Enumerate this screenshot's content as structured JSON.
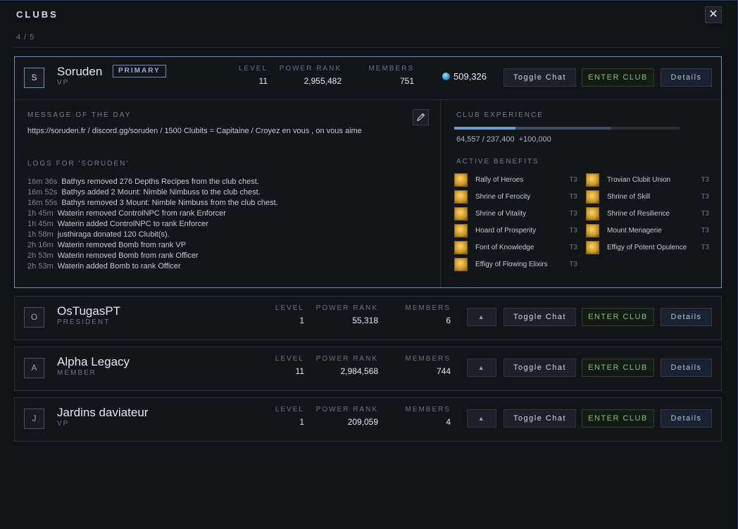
{
  "window": {
    "title": "CLUBS",
    "count": "4 / 5",
    "close_label": "✕"
  },
  "buttons": {
    "toggle_chat": "Toggle Chat",
    "enter_club": "ENTER CLUB",
    "details": "Details",
    "up": "▲"
  },
  "stat_labels": {
    "level": "LEVEL",
    "power_rank": "POWER RANK",
    "members": "MEMBERS"
  },
  "primary_club": {
    "initial": "S",
    "name": "Soruden",
    "badge": "PRIMARY",
    "rank": "VP",
    "level": "11",
    "power_rank": "2,955,482",
    "members": "751",
    "currency": "509,326",
    "motd_label": "MESSAGE OF THE DAY",
    "motd": "https://soruden.fr / discord.gg/soruden / 1500 Clubits = Capitaine / Croyez en vous , on vous aime",
    "logs_label": "LOGS FOR 'SORUDEN'",
    "logs": [
      {
        "time": "16m 36s",
        "text": "Bathys removed 276 Depths Recipes from the club chest."
      },
      {
        "time": "16m 52s",
        "text": "Bathys added 2 Mount: Nimble Nimbuss to the club chest."
      },
      {
        "time": "16m 55s",
        "text": "Bathys removed 3 Mount: Nimble Nimbuss from the club chest."
      },
      {
        "time": "1h 45m",
        "text": "Waterin removed ControlNPC from rank Enforcer"
      },
      {
        "time": "1h 45m",
        "text": "Waterin added ControlNPC to rank Enforcer"
      },
      {
        "time": "1h 58m",
        "text": "justhiraga donated 120 Clubit(s)."
      },
      {
        "time": "2h 16m",
        "text": "Waterin removed Bomb from rank VP"
      },
      {
        "time": "2h 53m",
        "text": "Waterin removed Bomb from rank Officer"
      },
      {
        "time": "2h 53m",
        "text": "Waterin added Bomb to rank Officer"
      }
    ],
    "experience_label": "CLUB EXPERIENCE",
    "experience_text": "64,557 / 237,400",
    "experience_bonus": "+100,000",
    "experience_fraction": 0.272,
    "experience_bonus_fraction": 0.421,
    "benefits_label": "ACTIVE BENEFITS",
    "benefits": [
      {
        "name": "Rally of Heroes",
        "tier": "T3",
        "icon": "rally-icon"
      },
      {
        "name": "Trovian Clubit Union",
        "tier": "T3",
        "icon": "union-icon"
      },
      {
        "name": "Shrine of Ferocity",
        "tier": "T3",
        "icon": "ferocity-icon"
      },
      {
        "name": "Shrine of Skill",
        "tier": "T3",
        "icon": "skill-icon"
      },
      {
        "name": "Shrine of Vitality",
        "tier": "T3",
        "icon": "vitality-icon"
      },
      {
        "name": "Shrine of Resilience",
        "tier": "T3",
        "icon": "resilience-icon"
      },
      {
        "name": "Hoard of Prosperity",
        "tier": "T3",
        "icon": "prosperity-icon"
      },
      {
        "name": "Mount Menagerie",
        "tier": "T3",
        "icon": "menagerie-icon"
      },
      {
        "name": "Font of Knowledge",
        "tier": "T3",
        "icon": "knowledge-icon"
      },
      {
        "name": "Effigy of Potent Opulence",
        "tier": "T3",
        "icon": "opulence-icon"
      },
      {
        "name": "Effigy of Flowing Elixirs",
        "tier": "T3",
        "icon": "elixirs-icon"
      }
    ]
  },
  "other_clubs": [
    {
      "initial": "O",
      "name": "OsTugasPT",
      "rank": "PRESIDENT",
      "level": "1",
      "power_rank": "55,318",
      "members": "6"
    },
    {
      "initial": "A",
      "name": "Alpha Legacy",
      "rank": "MEMBER",
      "level": "11",
      "power_rank": "2,984,568",
      "members": "744"
    },
    {
      "initial": "J",
      "name": "Jardins daviateur",
      "rank": "VP",
      "level": "1",
      "power_rank": "209,059",
      "members": "4"
    }
  ]
}
